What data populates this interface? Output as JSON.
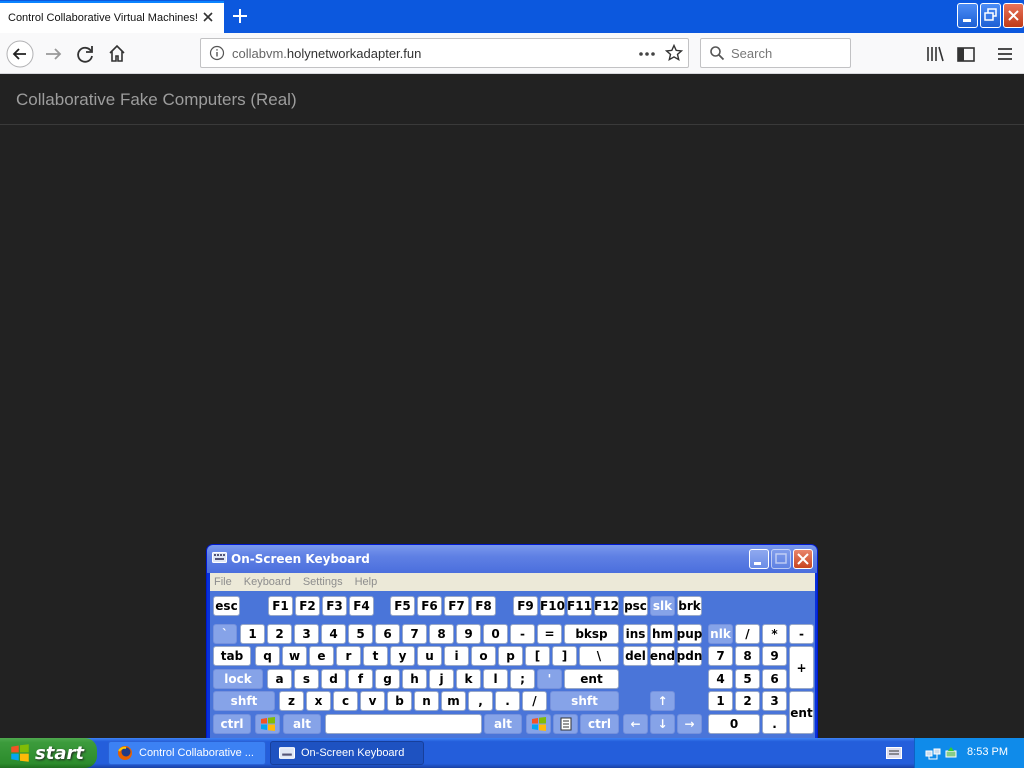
{
  "browser": {
    "tab_title": "Control Collaborative Virtual Machines!",
    "url_host": "collabvm.",
    "url_domain": "holynetworkadapter.fun",
    "search_placeholder": "Search"
  },
  "page": {
    "brand": "Collaborative Fake Computers (Real)"
  },
  "osk": {
    "title": "On-Screen Keyboard",
    "menu": [
      "File",
      "Keyboard",
      "Settings",
      "Help"
    ],
    "keys": {
      "esc": "esc",
      "f1": "F1",
      "f2": "F2",
      "f3": "F3",
      "f4": "F4",
      "f5": "F5",
      "f6": "F6",
      "f7": "F7",
      "f8": "F8",
      "f9": "F9",
      "f10": "F10",
      "f11": "F11",
      "f12": "F12",
      "psc": "psc",
      "slk": "slk",
      "brk": "brk",
      "backtick": "`",
      "n1": "1",
      "n2": "2",
      "n3": "3",
      "n4": "4",
      "n5": "5",
      "n6": "6",
      "n7": "7",
      "n8": "8",
      "n9": "9",
      "n0": "0",
      "minus": "-",
      "equals": "=",
      "bksp": "bksp",
      "ins": "ins",
      "hm": "hm",
      "pup": "pup",
      "nlk": "nlk",
      "slash": "/",
      "star": "*",
      "npminus": "-",
      "tab": "tab",
      "q": "q",
      "w": "w",
      "e": "e",
      "r": "r",
      "t": "t",
      "y": "y",
      "u": "u",
      "i": "i",
      "o": "o",
      "p": "p",
      "lbracket": "[",
      "rbracket": "]",
      "backslash": "\\",
      "del": "del",
      "end": "end",
      "pdn": "pdn",
      "np7": "7",
      "np8": "8",
      "np9": "9",
      "plus": "+",
      "lock": "lock",
      "a": "a",
      "s": "s",
      "d": "d",
      "f": "f",
      "g": "g",
      "h": "h",
      "j": "j",
      "k": "k",
      "l": "l",
      "semicolon": ";",
      "quote": "'",
      "ent": "ent",
      "np4": "4",
      "np5": "5",
      "np6": "6",
      "shft": "shft",
      "z": "z",
      "x": "x",
      "c": "c",
      "v": "v",
      "b": "b",
      "n": "n",
      "m": "m",
      "comma": ",",
      "period": ".",
      "fslash": "/",
      "rshft": "shft",
      "up": "↑",
      "np1": "1",
      "np2": "2",
      "np3": "3",
      "npent": "ent",
      "ctrl": "ctrl",
      "alt": "alt",
      "ralt": "alt",
      "rctrl": "ctrl",
      "left": "←",
      "down": "↓",
      "right": "→",
      "np0": "0",
      "npdot": "."
    }
  },
  "taskbar": {
    "start_label": "start",
    "tasks": [
      "Control Collaborative ...",
      "On-Screen Keyboard"
    ],
    "clock": "8:53 PM"
  }
}
